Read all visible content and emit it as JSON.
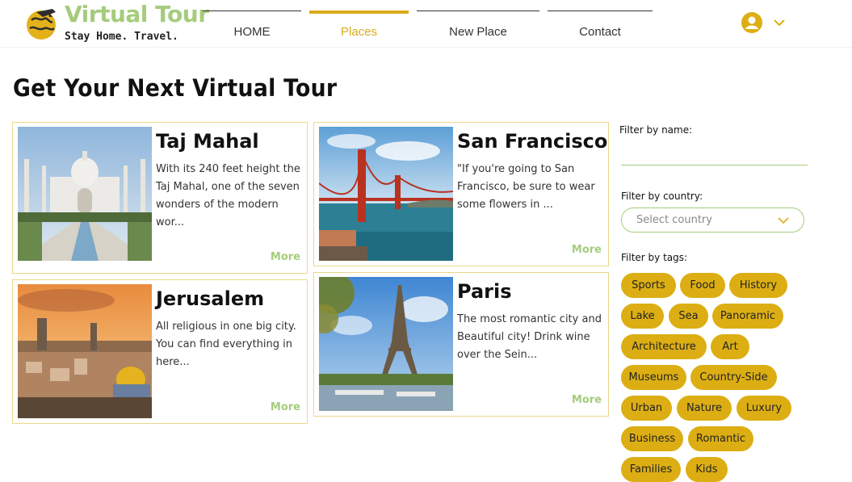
{
  "brand": {
    "title": "Virtual Tour",
    "tagline": "Stay Home. Travel.",
    "logo_icon": "globe-airplane-icon",
    "title_color": "#a5cc7d"
  },
  "nav": {
    "items": [
      {
        "label": "HOME",
        "active": false
      },
      {
        "label": "Places",
        "active": true
      },
      {
        "label": "New Place",
        "active": false
      },
      {
        "label": "Contact",
        "active": false
      }
    ],
    "accent_color": "#d9ac1b"
  },
  "user_menu": {
    "icon": "user-avatar-icon",
    "chevron": "chevron-down-icon"
  },
  "page": {
    "title": "Get Your Next Virtual Tour"
  },
  "cards": [
    {
      "name": "Taj Mahal",
      "description": "With its 240 feet height the Taj Mahal, one of the seven wonders of the modern wor...",
      "more": "More",
      "image": "taj-mahal-photo"
    },
    {
      "name": "San Francisco",
      "description": "\"If you're going to San Francisco, be sure to wear some flowers in ...",
      "more": "More",
      "image": "golden-gate-bridge-photo"
    },
    {
      "name": "Jerusalem",
      "description": "All religious in one big city. You can find everything in here...",
      "more": "More",
      "image": "jerusalem-skyline-photo"
    },
    {
      "name": "Paris",
      "description": "The most romantic city and Beautiful city! Drink wine over the Sein...",
      "more": "More",
      "image": "eiffel-tower-photo"
    }
  ],
  "filters": {
    "name_label": "Filter by name:",
    "name_value": "",
    "country_label": "Filter by country:",
    "country_placeholder": "Select country",
    "tags_label": "Filter by tags:",
    "tags": [
      "Sports",
      "Food",
      "History",
      "Lake",
      "Sea",
      "Panoramic",
      "Architecture",
      "Art",
      "Museums",
      "Country-Side",
      "Urban",
      "Nature",
      "Luxury",
      "Business",
      "Romantic",
      "Families",
      "Kids"
    ],
    "tag_color": "#dcae14"
  }
}
